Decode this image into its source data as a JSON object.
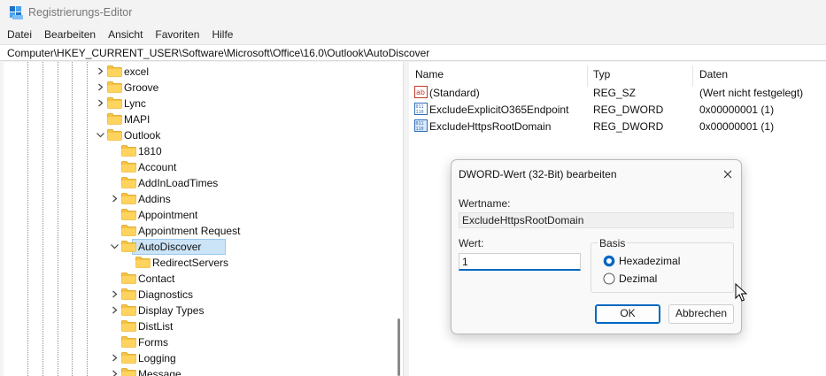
{
  "window": {
    "title": "Registrierungs-Editor"
  },
  "menu": [
    "Datei",
    "Bearbeiten",
    "Ansicht",
    "Favoriten",
    "Hilfe"
  ],
  "address": "Computer\\HKEY_CURRENT_USER\\Software\\Microsoft\\Office\\16.0\\Outlook\\AutoDiscover",
  "tree": [
    {
      "label": "excel",
      "expander": "collapsed"
    },
    {
      "label": "Groove",
      "expander": "collapsed"
    },
    {
      "label": "Lync",
      "expander": "collapsed"
    },
    {
      "label": "MAPI",
      "expander": "none"
    },
    {
      "label": "Outlook",
      "expander": "expanded"
    },
    {
      "label": "1810",
      "expander": "none"
    },
    {
      "label": "Account",
      "expander": "none"
    },
    {
      "label": "AddInLoadTimes",
      "expander": "none"
    },
    {
      "label": "Addins",
      "expander": "collapsed"
    },
    {
      "label": "Appointment",
      "expander": "none"
    },
    {
      "label": "Appointment Request",
      "expander": "none"
    },
    {
      "label": "AutoDiscover",
      "expander": "expanded",
      "selected": true
    },
    {
      "label": "RedirectServers",
      "expander": "none"
    },
    {
      "label": "Contact",
      "expander": "none"
    },
    {
      "label": "Diagnostics",
      "expander": "collapsed"
    },
    {
      "label": "Display Types",
      "expander": "collapsed"
    },
    {
      "label": "DistList",
      "expander": "none"
    },
    {
      "label": "Forms",
      "expander": "none"
    },
    {
      "label": "Logging",
      "expander": "collapsed"
    },
    {
      "label": "Message",
      "expander": "collapsed"
    }
  ],
  "columns": {
    "name": "Name",
    "type": "Typ",
    "data": "Daten"
  },
  "values": [
    {
      "name": "(Standard)",
      "type": "REG_SZ",
      "data": "(Wert nicht festgelegt)",
      "icon": "string-value-icon"
    },
    {
      "name": "ExcludeExplicitO365Endpoint",
      "type": "REG_DWORD",
      "data": "0x00000001 (1)",
      "icon": "dword-value-icon"
    },
    {
      "name": "ExcludeHttpsRootDomain",
      "type": "REG_DWORD",
      "data": "0x00000001 (1)",
      "icon": "dword-value-icon"
    }
  ],
  "dialog": {
    "title": "DWORD-Wert (32-Bit) bearbeiten",
    "name_label": "Wertname:",
    "name_value": "ExcludeHttpsRootDomain",
    "value_label": "Wert:",
    "value": "1",
    "basis_label": "Basis",
    "radio_hex": "Hexadezimal",
    "radio_dec": "Dezimal",
    "selected_basis": "Hexadezimal",
    "ok": "OK",
    "cancel": "Abbrechen"
  },
  "colors": {
    "accent": "#0067c0",
    "selection": "#cce4f7",
    "folder": "#f5c242"
  }
}
